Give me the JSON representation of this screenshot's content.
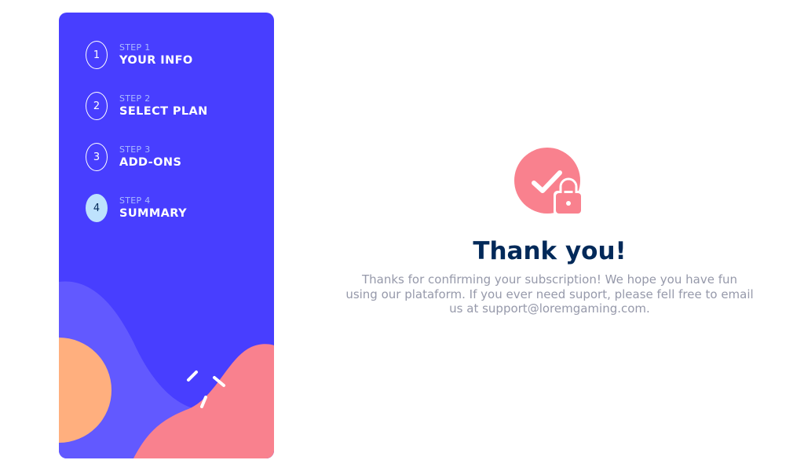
{
  "sidebar": {
    "steps": [
      {
        "number": "1",
        "label": "STEP 1",
        "name": "YOUR INFO",
        "active": false
      },
      {
        "number": "2",
        "label": "STEP 2",
        "name": "SELECT PLAN",
        "active": false
      },
      {
        "number": "3",
        "label": "STEP 3",
        "name": "ADD-ONS",
        "active": false
      },
      {
        "number": "4",
        "label": "STEP 4",
        "name": "SUMMARY",
        "active": true
      }
    ]
  },
  "main": {
    "icon": "checkmark-lock-icon",
    "title": "Thank you!",
    "message": "Thanks for confirming your subscription! We hope you have fun using our plataform. If you ever need suport, please fell free to email us at support@loremgaming.com."
  },
  "colors": {
    "sidebar_bg": "#483eff",
    "active_step": "#bee2fd",
    "title": "#022959",
    "message": "#9699aa",
    "accent_pink": "#f9818e",
    "accent_orange": "#ffaf7e"
  }
}
